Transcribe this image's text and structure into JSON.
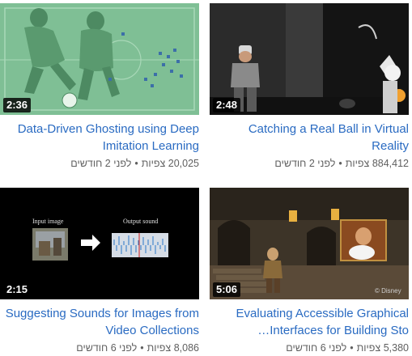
{
  "videos": [
    {
      "duration": "2:36",
      "title": "Data-Driven Ghosting using Deep Imitation Learning",
      "views": "20,025 צפיות",
      "age": "לפני 2 חודשים"
    },
    {
      "duration": "2:48",
      "title": "Catching a Real Ball in Virtual Reality",
      "views": "884,412 צפיות",
      "age": "לפני 2 חודשים"
    },
    {
      "duration": "2:15",
      "title": "Suggesting Sounds for Images from Video Collections",
      "views": "8,086 צפיות",
      "age": "לפני 6 חודשים",
      "thumb_labels": {
        "input": "Input image",
        "output": "Output sound"
      }
    },
    {
      "duration": "5:06",
      "title": "Evaluating Accessible Graphical Interfaces for Building Sto…",
      "views": "5,380 צפיות",
      "age": "לפני 6 חודשים",
      "thumb_watermark": "© Disney"
    }
  ],
  "separator": "•"
}
